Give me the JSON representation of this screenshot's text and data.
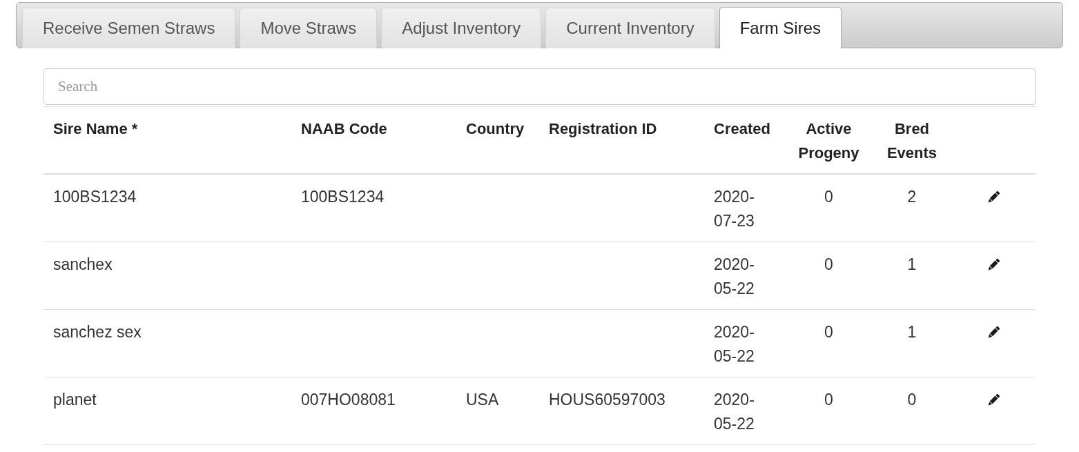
{
  "tabs": [
    {
      "label": "Receive Semen Straws",
      "selected": false
    },
    {
      "label": "Move Straws",
      "selected": false
    },
    {
      "label": "Adjust Inventory",
      "selected": false
    },
    {
      "label": "Current Inventory",
      "selected": false
    },
    {
      "label": "Farm Sires",
      "selected": true
    }
  ],
  "search": {
    "placeholder": "Search"
  },
  "table": {
    "columns": [
      "Sire Name *",
      "NAAB Code",
      "Country",
      "Registration ID",
      "Created",
      "Active Progeny",
      "Bred Events"
    ],
    "rows": [
      {
        "sire_name": "100BS1234",
        "naab_code": "100BS1234",
        "created": "2020-07-23",
        "active_progeny": "0",
        "bred_events": "2"
      },
      {
        "sire_name": "sanchex",
        "created": "2020-05-22",
        "active_progeny": "0",
        "bred_events": "1"
      },
      {
        "sire_name": "sanchez sex",
        "created": "2020-05-22",
        "active_progeny": "0",
        "bred_events": "1"
      },
      {
        "sire_name": "planet",
        "naab_code": "007HO08081",
        "country": "USA",
        "registration_id": "HOUS60597003",
        "created": "2020-05-22",
        "active_progeny": "0",
        "bred_events": "0"
      }
    ]
  }
}
